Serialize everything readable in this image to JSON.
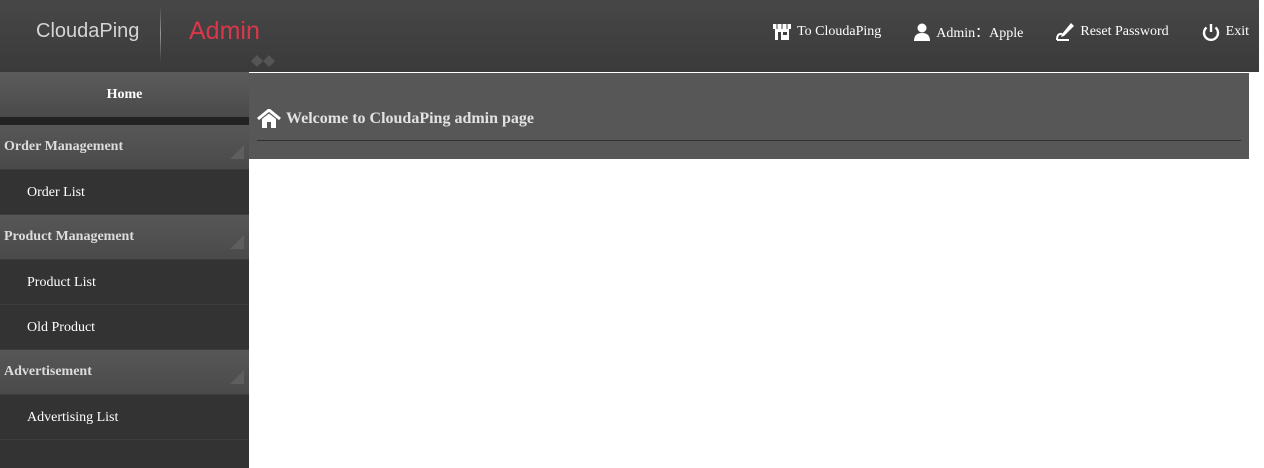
{
  "header": {
    "brand": "CloudaPing",
    "title": "Admin",
    "nav": {
      "to_site": "To CloudaPing",
      "admin_label": "Admin：Apple",
      "reset_password": "Reset Password",
      "exit": "Exit"
    },
    "icons": [
      "shop-icon",
      "user-icon",
      "pen-icon",
      "power-icon"
    ]
  },
  "sidebar": {
    "home": "Home",
    "groups": [
      {
        "label": "Order Management",
        "items": [
          "Order List"
        ]
      },
      {
        "label": "Product Management",
        "items": [
          "Product List",
          "Old Product"
        ]
      },
      {
        "label": "Advertisement",
        "items": [
          "Advertising List"
        ]
      }
    ]
  },
  "main": {
    "welcome": "Welcome to CloudaPing admin page",
    "icon": "home-icon"
  },
  "colors": {
    "topbar": "#3f3f3f",
    "admin_accent": "#d9374a",
    "sidebar": "#333333",
    "group_header": "#505050",
    "main_header": "#575757"
  }
}
